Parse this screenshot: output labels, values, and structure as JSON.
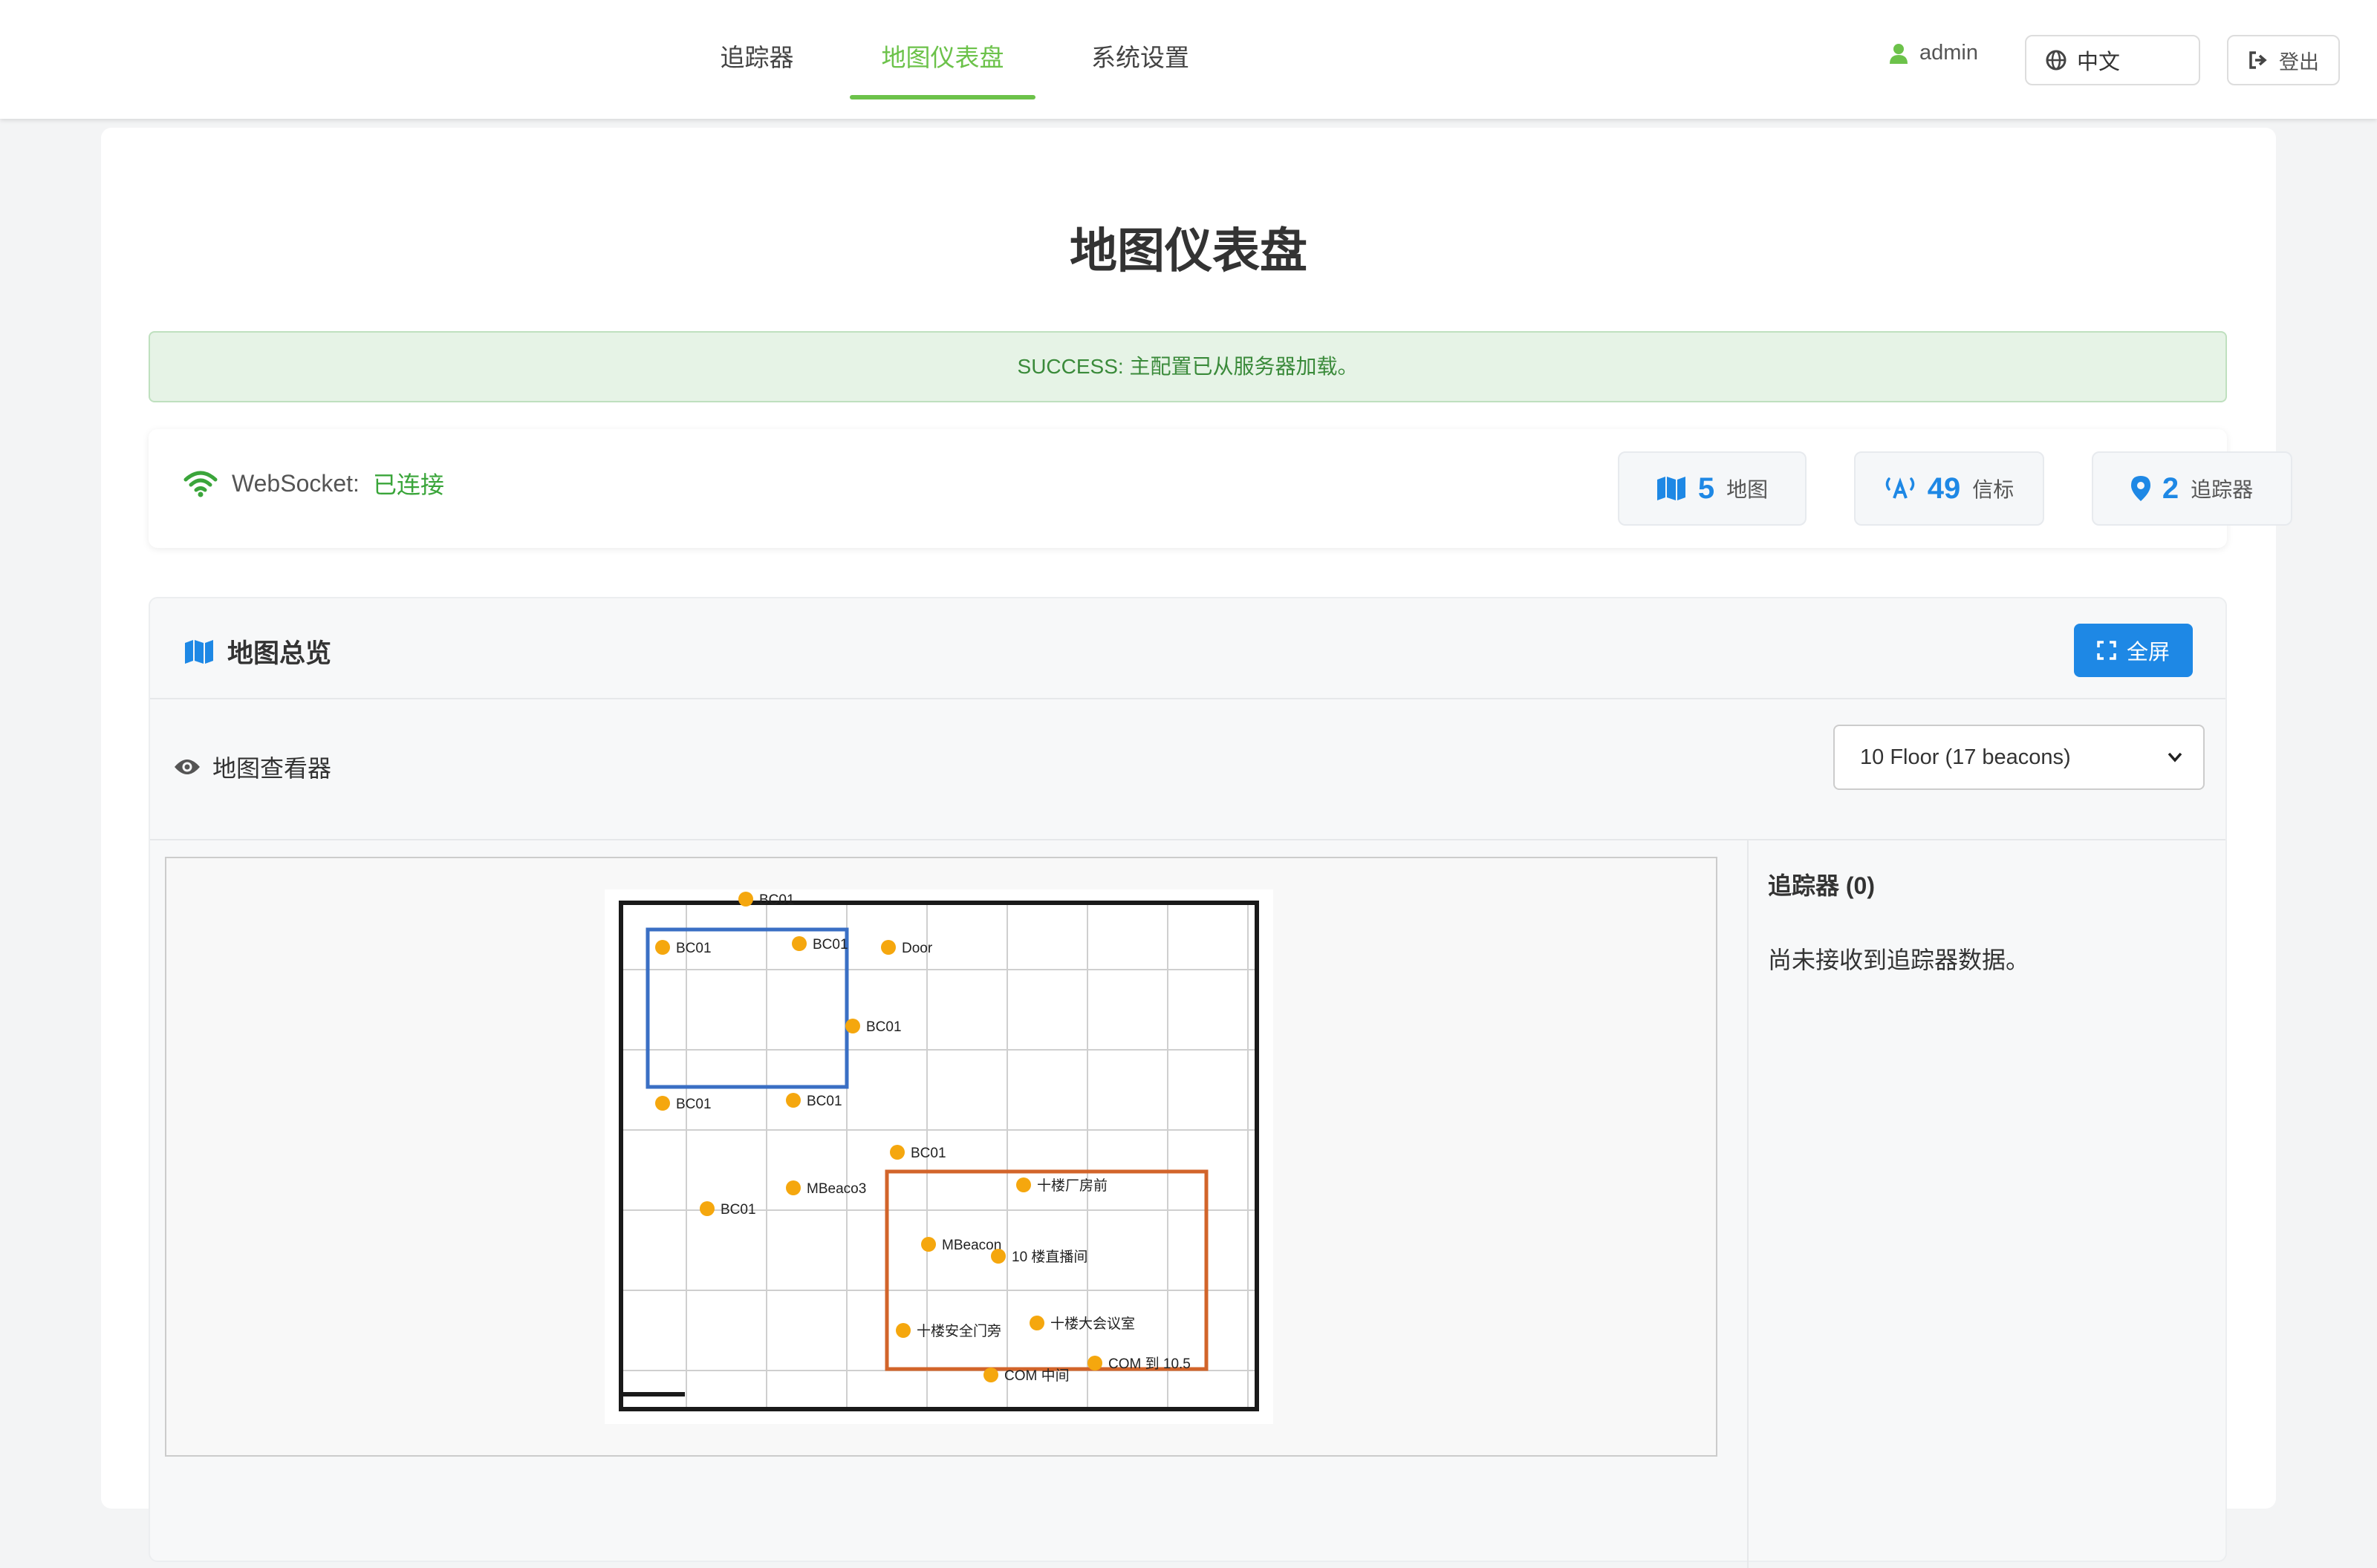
{
  "nav": {
    "tabs": [
      {
        "label": "追踪器",
        "active": false
      },
      {
        "label": "地图仪表盘",
        "active": true
      },
      {
        "label": "系统设置",
        "active": false
      }
    ],
    "user": "admin",
    "language": "中文",
    "logout": "登出",
    "accent_color": "#6cc24a"
  },
  "page": {
    "title": "地图仪表盘",
    "alert": "SUCCESS: 主配置已从服务器加载。"
  },
  "status": {
    "ws_label": "WebSocket:",
    "ws_state": "已连接",
    "stats": [
      {
        "icon": "map-icon",
        "value": "5",
        "label": "地图"
      },
      {
        "icon": "beacon-icon",
        "value": "49",
        "label": "信标"
      },
      {
        "icon": "pin-icon",
        "value": "2",
        "label": "追踪器"
      }
    ]
  },
  "overview": {
    "title": "地图总览",
    "fullscreen": "全屏",
    "viewer_label": "地图查看器",
    "floor_select": "10 Floor (17 beacons)",
    "tracker_title": "追踪器 (0)",
    "tracker_empty": "尚未接收到追踪器数据。"
  },
  "map": {
    "beacons": [
      {
        "label": "BC01"
      },
      {
        "label": "BC01"
      },
      {
        "label": "BC01"
      },
      {
        "label": "Door"
      },
      {
        "label": "BC01"
      },
      {
        "label": "BC01"
      },
      {
        "label": "BC01"
      },
      {
        "label": "BC01"
      },
      {
        "label": "MBeaco3"
      },
      {
        "label": "BC01"
      },
      {
        "label": "十楼厂房前"
      },
      {
        "label": "MBeacon"
      },
      {
        "label": "10 楼直播间"
      },
      {
        "label": "十楼安全门旁"
      },
      {
        "label": "十楼大会议室"
      },
      {
        "label": "COM 到 10.5"
      },
      {
        "label": "COM 中间"
      }
    ],
    "zone_colors": {
      "zone_a": "#3a6fc4",
      "zone_b": "#d2642a"
    },
    "beacon_color": "#f5a70e"
  }
}
